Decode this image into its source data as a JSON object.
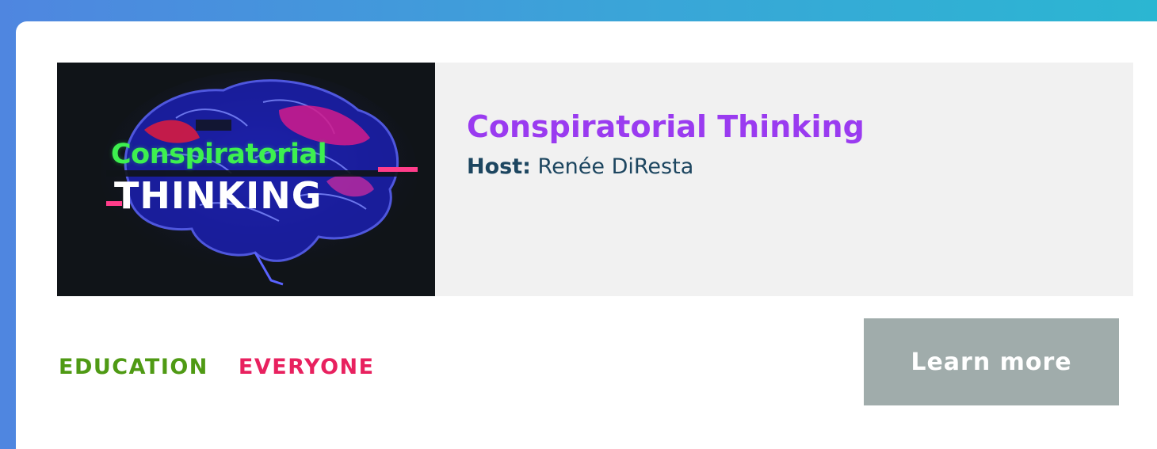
{
  "podcast": {
    "title": "Conspiratorial Thinking",
    "host_label": "Host:",
    "host_name": "Renée DiResta",
    "thumbnail": {
      "line1": "Conspiratorial",
      "line2": "THINKING",
      "icon": "brain-artwork"
    }
  },
  "tags": [
    {
      "label": "EDUCATION",
      "color": "#4f9a14"
    },
    {
      "label": "EVERYONE",
      "color": "#e8215f"
    }
  ],
  "cta": {
    "label": "Learn more",
    "color": "#a0acab"
  },
  "colors": {
    "title": "#9a3bf0",
    "host": "#1d4660",
    "banner_bg": "#f1f1f1"
  }
}
